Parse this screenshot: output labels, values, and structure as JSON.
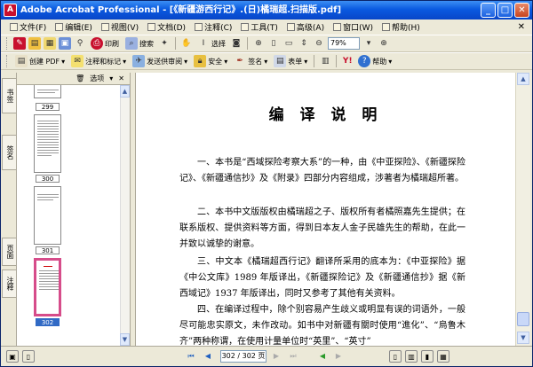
{
  "window": {
    "title": "Adobe Acrobat Professional - [《新疆游西行记》.(日)橘瑞超.扫描版.pdf]",
    "logo": "A",
    "buttons": [
      "_",
      "□",
      "✕"
    ]
  },
  "menu": {
    "items": [
      "文件(F)",
      "编辑(E)",
      "视图(V)",
      "文档(D)",
      "注释(C)",
      "工具(T)",
      "高级(A)",
      "窗口(W)",
      "帮助(H)"
    ],
    "close": "✕"
  },
  "toolbar1": {
    "print_label": "印刷",
    "search_label": "搜索",
    "select_label": "选择",
    "zoom": "79%"
  },
  "toolbar2": {
    "create_pdf": "创建 PDF",
    "comment": "注释和标记",
    "send_review": "发送供审阅",
    "secure": "安全",
    "sign": "签名",
    "forms": "表单",
    "help": "帮助"
  },
  "nav_tabs": [
    "书签",
    "签名",
    "页面",
    "注释"
  ],
  "panel": {
    "options": "选项",
    "close": "✕",
    "pages": [
      {
        "label": "299",
        "selected": false
      },
      {
        "label": "300",
        "selected": false
      },
      {
        "label": "301",
        "selected": false
      },
      {
        "label": "302",
        "selected": true
      }
    ]
  },
  "document": {
    "title": "编 译 说 明",
    "paragraphs": [
      "一、本书是“西域探险考察大系”的一种，由《中亚探险》、《新疆探险记》、《新疆通信抄》及《附录》四部分内容组成，涉著者为橘瑞超所著。",
      "二、本书中文版版权由橘瑞超之子、版权所有者橘照嘉先生提供；在联系版权、提供资料等方面，得到日本友人金子民雄先生的帮助，在此一并致以诚挚的谢意。",
      "三、中文本《橘瑞超西行记》翻译所采用的底本为：《中亚探险》据《中公文库》1989 年版译出，《新疆探险记》及《新疆通信抄》据《新西域记》1937 年版译出，同时又参考了其他有关资料。",
      "四、在编译过程中，除个别容易产生歧义或明显有误的词语外，一般尽可能忠实原文，未作改动。如书中对新疆有關时使用“進化”、“烏鲁木齐”两种称谓，在使用计量单位时“英里”、“英寸”"
    ]
  },
  "status": {
    "page": "302 / 302 页"
  },
  "colors": {
    "title_bar": "#0a5ae0",
    "selection": "#316ac5",
    "selected_thumb_border": "#d64c8a"
  }
}
